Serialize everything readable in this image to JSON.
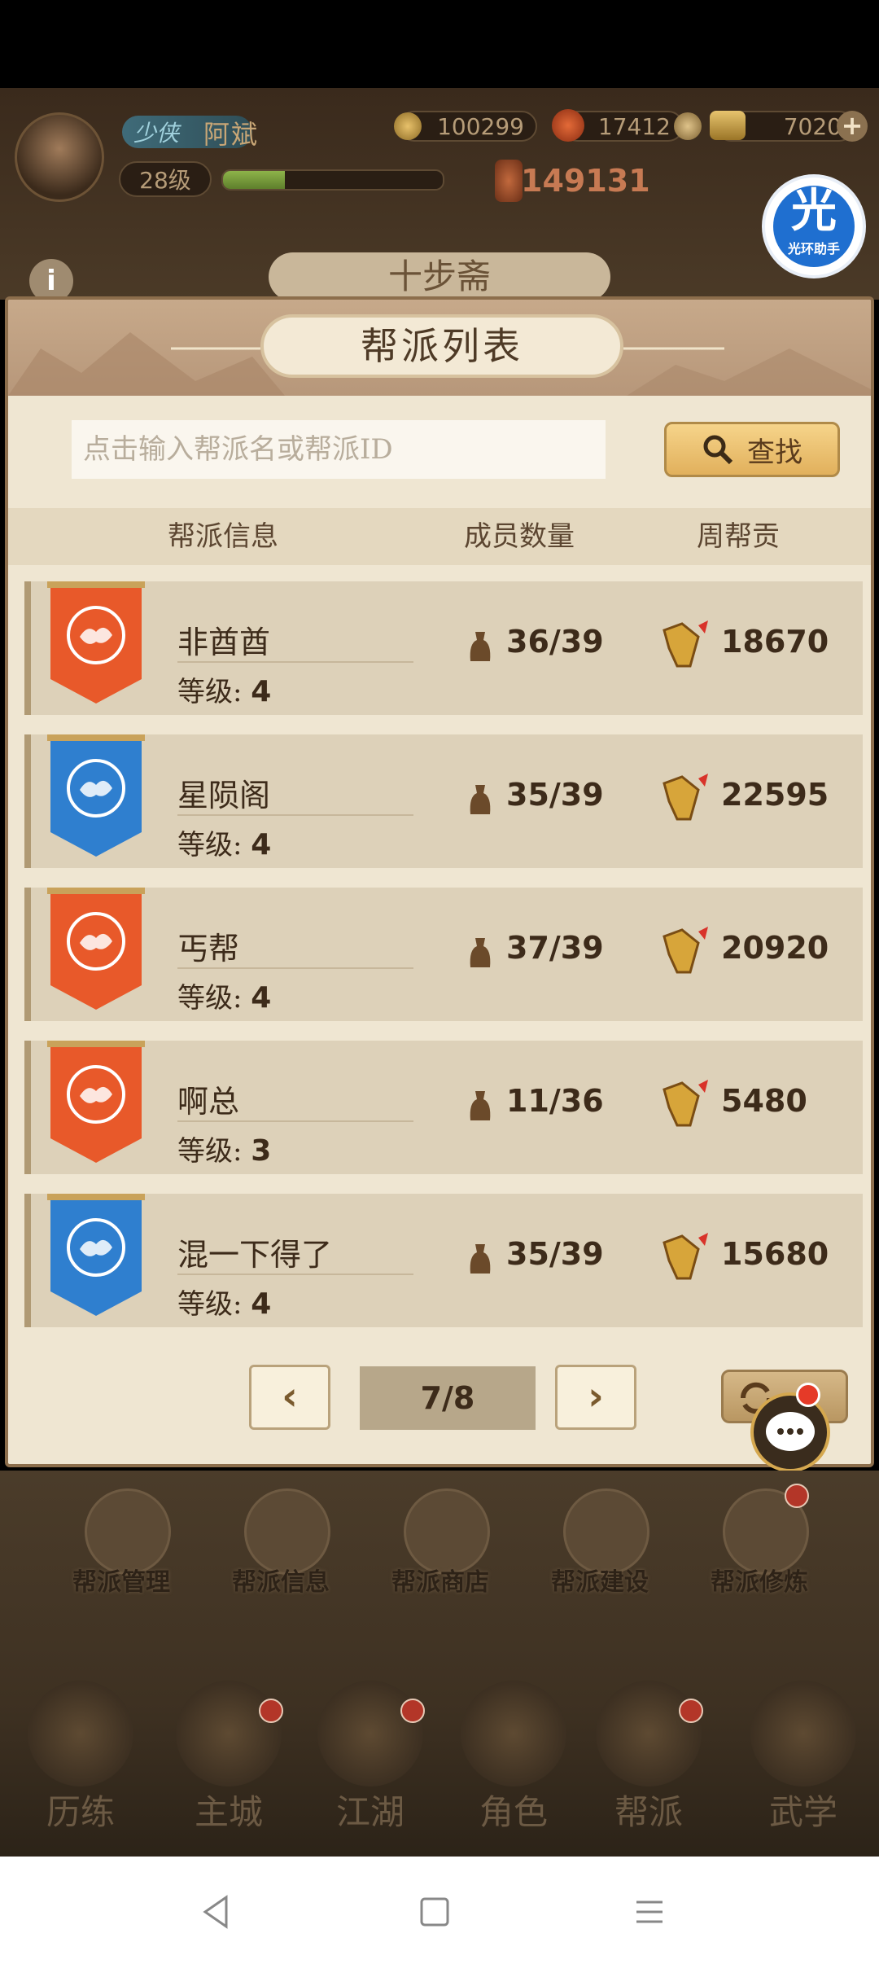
{
  "player": {
    "rank_title": "少侠",
    "name": "阿斌",
    "level": "28级",
    "xp_fraction": 0.28,
    "copper": "100299",
    "jade": "17412",
    "gold": "7020",
    "power": "149131"
  },
  "background": {
    "location_title": "十步斋"
  },
  "helper": {
    "logo_char": "光",
    "name": "光环助手"
  },
  "dialog": {
    "title": "帮派列表",
    "search_placeholder": "点击输入帮派名或帮派ID",
    "find_button": "查找",
    "columns": [
      "帮派信息",
      "成员数量",
      "周帮贡"
    ],
    "level_prefix": "等级:",
    "rows": [
      {
        "name": "非酋酋",
        "level": "4",
        "members": "36/39",
        "contribution": "18670",
        "banner": "orange"
      },
      {
        "name": "星陨阁",
        "level": "4",
        "members": "35/39",
        "contribution": "22595",
        "banner": "blue"
      },
      {
        "name": "丐帮",
        "level": "4",
        "members": "37/39",
        "contribution": "20920",
        "banner": "orange"
      },
      {
        "name": "啊总",
        "level": "3",
        "members": "11/36",
        "contribution": "5480",
        "banner": "orange"
      },
      {
        "name": "混一下得了",
        "level": "4",
        "members": "35/39",
        "contribution": "15680",
        "banner": "blue"
      }
    ],
    "pagination": {
      "current": "7/8"
    },
    "prev_icon": "‹",
    "next_icon": "›"
  },
  "guild_functions": [
    "帮派管理",
    "帮派信息",
    "帮派商店",
    "帮派建设",
    "帮派修炼"
  ],
  "bottom_nav": [
    "历练",
    "主城",
    "江湖",
    "角色",
    "帮派",
    "武学"
  ],
  "colors": {
    "banner_orange": "#e8592a",
    "banner_blue": "#2f7fcf",
    "accent_gold": "#e1b05c"
  }
}
